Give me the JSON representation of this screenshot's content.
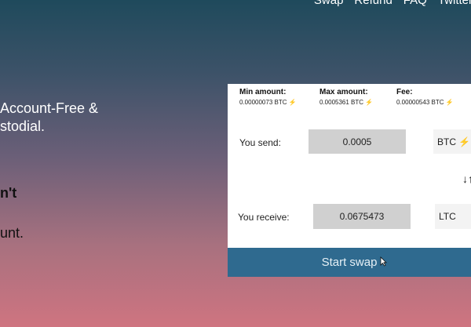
{
  "nav": {
    "items": [
      "Swap",
      "Refund",
      "FAQ",
      "Twitter"
    ]
  },
  "hero": {
    "line1": "Account-Free &",
    "line2": "stodial.",
    "line3": "n't",
    "line4": "unt."
  },
  "stats": {
    "min_label": "Min amount:",
    "min_value": "0.00000073 BTC",
    "max_label": "Max amount:",
    "max_value": "0.0005361 BTC",
    "fee_label": "Fee:",
    "fee_value": "0.00000543 BTC",
    "bolt": "⚡"
  },
  "send": {
    "label": "You send:",
    "value": "0.0005",
    "currency": "BTC"
  },
  "receive": {
    "label": "You receive:",
    "value": "0.0675473",
    "currency": "LTC"
  },
  "swap_arrows": "↓↑",
  "start_button": "Start swap",
  "colors": {
    "button": "#2f6a8f",
    "bolt": "#f2c21b",
    "input_bg": "#d0d0d0"
  }
}
